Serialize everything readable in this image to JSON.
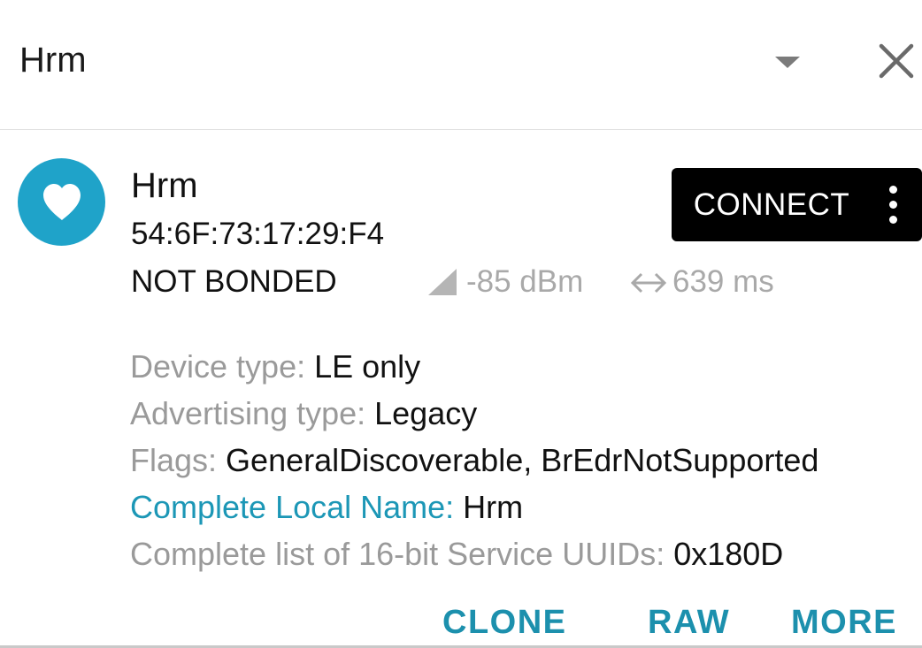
{
  "header": {
    "title": "Hrm",
    "dropdown_icon": "arrow-drop-down-icon",
    "close_icon": "close-icon"
  },
  "device": {
    "icon": "heart-icon",
    "avatar_color": "#1fa3c9",
    "name": "Hrm",
    "address": "54:6F:73:17:29:F4",
    "bond_state": "NOT BONDED",
    "rssi": "-85 dBm",
    "interval": "639 ms",
    "connect_label": "CONNECT"
  },
  "details": [
    {
      "label": "Device type: ",
      "value": "LE only"
    },
    {
      "label": "Advertising type: ",
      "value": "Legacy"
    },
    {
      "label": "Flags: ",
      "value": "GeneralDiscoverable, BrEdrNotSupported"
    },
    {
      "label": "Complete Local Name: ",
      "value": "Hrm"
    },
    {
      "label": "Complete list of 16-bit Service UUIDs: ",
      "value": "0x180D"
    }
  ],
  "actions": {
    "clone": "CLONE",
    "raw": "RAW",
    "more": "MORE"
  },
  "colors": {
    "accent": "#1c90ad",
    "muted": "#9a9a9a"
  }
}
